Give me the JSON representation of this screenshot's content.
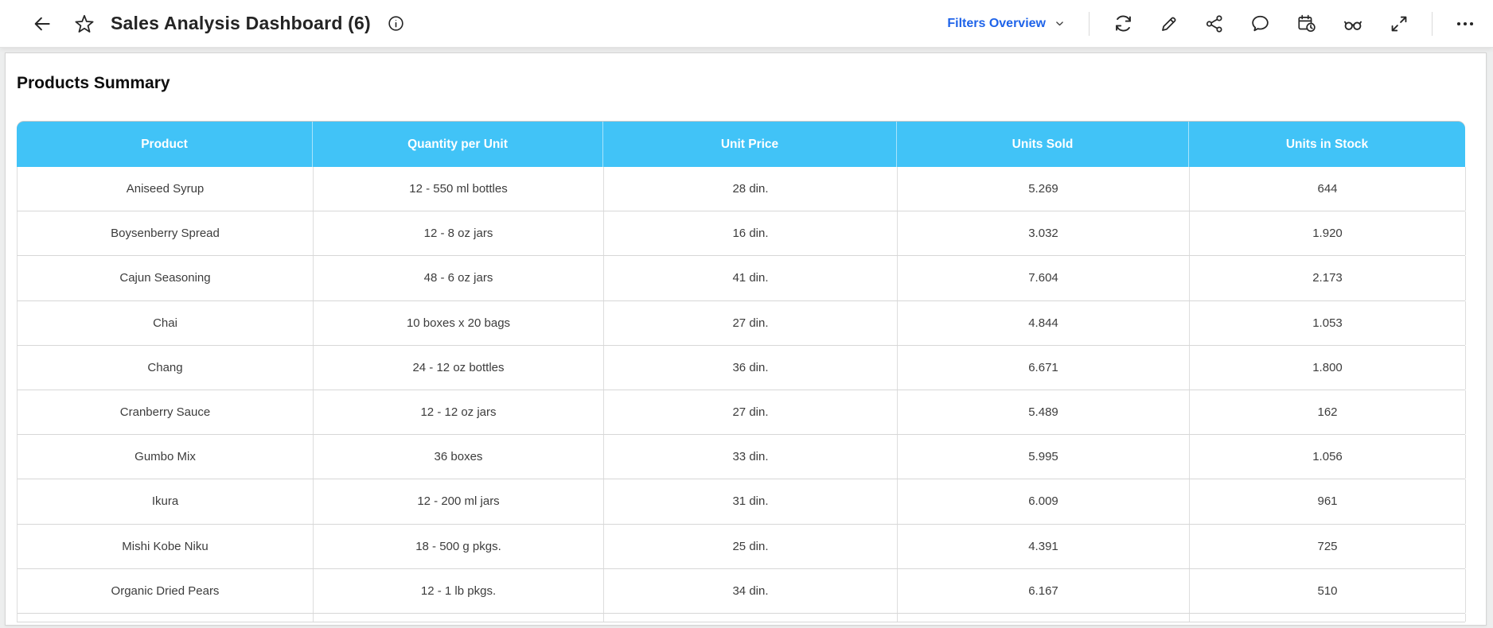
{
  "header": {
    "title": "Sales Analysis Dashboard (6)",
    "filters_dropdown": {
      "label": "Filters Overview",
      "icon": "chevron-down-icon"
    },
    "left_icons": [
      "back-arrow-icon",
      "star-icon",
      "info-icon"
    ],
    "right_icons": [
      "refresh-icon",
      "edit-pencil-icon",
      "share-icon",
      "comment-icon",
      "schedule-calendar-clock-icon",
      "glasses-preview-icon",
      "fullscreen-expand-icon",
      "more-ellipsis-icon"
    ]
  },
  "widget": {
    "title": "Products Summary"
  },
  "table": {
    "columns": [
      "Product",
      "Quantity per Unit",
      "Unit Price",
      "Units Sold",
      "Units in Stock"
    ],
    "rows": [
      [
        "Aniseed Syrup",
        "12 - 550 ml bottles",
        "28 din.",
        "5.269",
        "644"
      ],
      [
        "Boysenberry Spread",
        "12 - 8 oz jars",
        "16 din.",
        "3.032",
        "1.920"
      ],
      [
        "Cajun Seasoning",
        "48 - 6 oz jars",
        "41 din.",
        "7.604",
        "2.173"
      ],
      [
        "Chai",
        "10 boxes x 20 bags",
        "27 din.",
        "4.844",
        "1.053"
      ],
      [
        "Chang",
        "24 - 12 oz bottles",
        "36 din.",
        "6.671",
        "1.800"
      ],
      [
        "Cranberry Sauce",
        "12 - 12 oz jars",
        "27 din.",
        "5.489",
        "162"
      ],
      [
        "Gumbo Mix",
        "36 boxes",
        "33 din.",
        "5.995",
        "1.056"
      ],
      [
        "Ikura",
        "12 - 200 ml jars",
        "31 din.",
        "6.009",
        "961"
      ],
      [
        "Mishi Kobe Niku",
        "18 - 500 g pkgs.",
        "25 din.",
        "4.391",
        "725"
      ],
      [
        "Organic Dried Pears",
        "12 - 1 lb pkgs.",
        "34 din.",
        "6.167",
        "510"
      ]
    ]
  },
  "colors": {
    "table_header_bg": "#41c3f7",
    "accent_blue": "#1e63e9",
    "icon_color": "#262626",
    "row_border": "#d7d7d7"
  }
}
